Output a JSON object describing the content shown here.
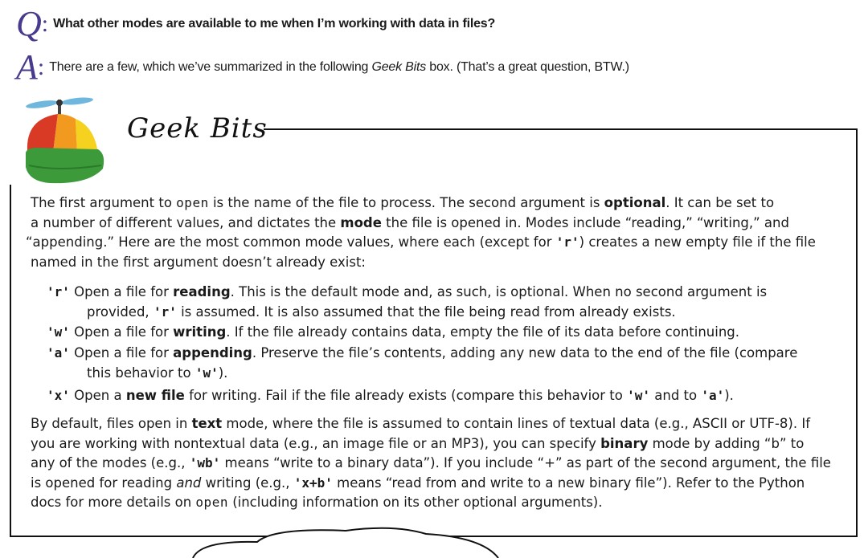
{
  "question": {
    "letter": "Q",
    "text": "What other modes are available to me when I’m working with data in files?"
  },
  "answer": {
    "letter": "A",
    "text_before": "There are a few, which we’ve summarized in the following ",
    "text_em": "Geek Bits",
    "text_after": " box. (That’s a great question, BTW.)"
  },
  "geek_bits": {
    "title": "Geek Bits",
    "icon": "propeller-hat-icon",
    "intro": {
      "s1": "The first argument to ",
      "code_open": "open",
      "s2": " is the name of the file to process. The second argument is ",
      "b_optional": "optional",
      "s3": ". It can be set to",
      "s4": "a number of different values, and dictates the ",
      "b_mode": "mode",
      "s5": " the file is opened in. Modes include “reading,” “writing,” and",
      "s6": "“appending.” Here are the most common mode values, where each (except for ",
      "code_r": "'r'",
      "s7": ") creates a new empty file if the file",
      "s8": "named in the first argument doesn’t already exist:"
    },
    "modes": [
      {
        "code": "'r'",
        "t1": " Open a file for ",
        "bold": "reading",
        "t2": ". This is the default mode and, as such, is optional. When no second argument is",
        "t3": "provided, ",
        "code2": "'r'",
        "t4": " is assumed. It is also assumed that the file being read from already exists."
      },
      {
        "code": "'w'",
        "t1": " Open a file for ",
        "bold": "writing",
        "t2": ". If the file already contains data, empty the file of its data before continuing."
      },
      {
        "code": "'a'",
        "t1": " Open a file for ",
        "bold": "appending",
        "t2": ". Preserve the file’s contents, adding any new data to the end of the file (compare",
        "t3": "this behavior to ",
        "code2": "'w'",
        "t4": ")."
      },
      {
        "code": "'x'",
        "t1": " Open a ",
        "bold": "new file",
        "t2": " for writing. Fail if the file already exists (compare this behavior to ",
        "code2": "'w'",
        "t3": " and to ",
        "code3": "'a'",
        "t4": ")."
      }
    ],
    "closing": {
      "s1": "By default, files open in ",
      "b_text": "text",
      "s2": " mode, where the file is assumed to contain lines of textual data (e.g., ASCII or UTF-8). If",
      "s3": "you are working with nontextual data (e.g., an image file or an MP3), you can specify ",
      "b_binary": "binary",
      "s4": " mode by adding “b” to",
      "s5": "any of the modes (e.g., ",
      "code_wb": "'wb'",
      "s6": " means “write to a binary data”). If you include “+” as part of the second argument, the file",
      "s7": "is opened for reading ",
      "em_and": "and",
      "s8": " writing (e.g., ",
      "code_xb": "'x+b'",
      "s9": " means “read from and write to a new binary file”). Refer to the Python",
      "s10": "docs for more details on ",
      "code_open": "open",
      "s11": " (including information on its other optional arguments)."
    }
  },
  "colors": {
    "qa_letter": "#4a3a8e",
    "hat_red": "#d93a26",
    "hat_orange": "#f29a1f",
    "hat_yellow": "#f4d21f",
    "hat_green": "#3d9a3a",
    "propeller_blue": "#6fb7dc"
  }
}
